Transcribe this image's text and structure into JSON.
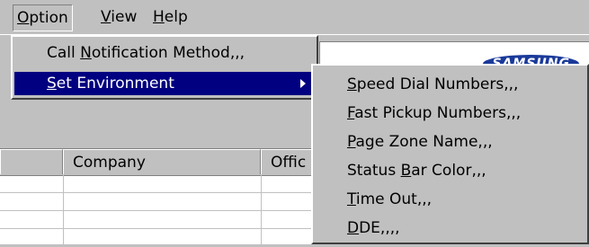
{
  "menubar": {
    "items": [
      {
        "label_pre": "",
        "label_u": "O",
        "label_post": "ption",
        "open": true
      },
      {
        "label_pre": "",
        "label_u": "V",
        "label_post": "iew",
        "open": false
      },
      {
        "label_pre": "",
        "label_u": "H",
        "label_post": "elp",
        "open": false
      }
    ]
  },
  "brand": {
    "logo_text": "SAMSUNG"
  },
  "option_menu": {
    "items": [
      {
        "pre": "Call ",
        "u": "N",
        "post": "otification Method,,,",
        "selected": false,
        "submenu": false
      },
      {
        "pre": "",
        "u": "S",
        "post": "et Environment",
        "selected": true,
        "submenu": true
      }
    ]
  },
  "env_submenu": {
    "items": [
      {
        "pre": "",
        "u": "S",
        "post": "peed Dial Numbers,,,"
      },
      {
        "pre": "",
        "u": "F",
        "post": "ast Pickup Numbers,,,"
      },
      {
        "pre": "",
        "u": "P",
        "post": "age Zone Name,,,"
      },
      {
        "pre": "Status ",
        "u": "B",
        "post": "ar Color,,,"
      },
      {
        "pre": "",
        "u": "T",
        "post": "ime Out,,,"
      },
      {
        "pre": "",
        "u": "D",
        "post": "DE,,,,"
      }
    ]
  },
  "grid": {
    "columns": [
      "",
      "Company",
      "Offic"
    ]
  }
}
